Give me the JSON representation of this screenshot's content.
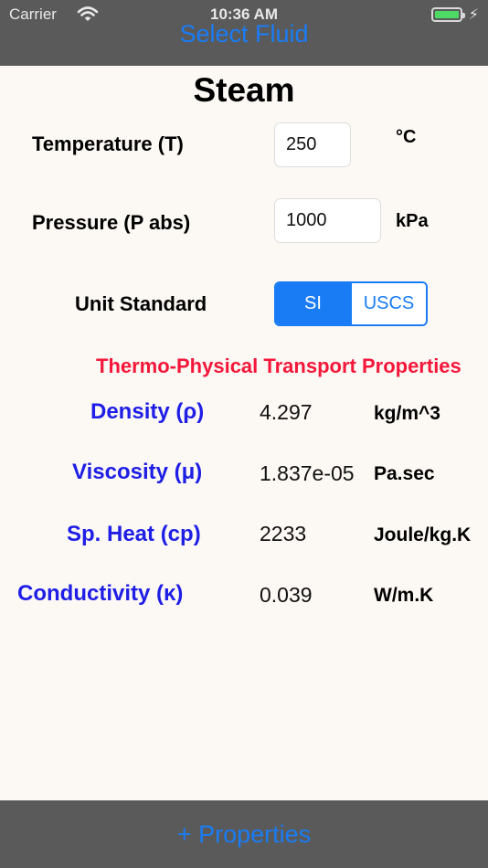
{
  "status_bar": {
    "carrier": "Carrier",
    "time": "10:36 AM",
    "wifi_icon": "wifi-icon",
    "battery_icon": "battery-icon",
    "charging_icon": "charging-bolt-icon"
  },
  "nav": {
    "select_fluid": "Select Fluid"
  },
  "fluid": {
    "name": "Steam"
  },
  "inputs": {
    "temperature": {
      "label": "Temperature (T)",
      "value": "250",
      "unit": "°C"
    },
    "pressure": {
      "label": "Pressure (P abs)",
      "value": "1000",
      "unit": "kPa"
    }
  },
  "unit_standard": {
    "label": "Unit Standard",
    "options": [
      "SI",
      "USCS"
    ],
    "selected": "SI"
  },
  "properties": {
    "title": "Thermo-Physical Transport Properties",
    "items": [
      {
        "label": "Density (ρ)",
        "value": "4.297",
        "unit": "kg/m^3"
      },
      {
        "label": "Viscosity (μ)",
        "value": "1.837e-05",
        "unit": "Pa.sec"
      },
      {
        "label": "Sp. Heat (cp)",
        "value": "2233",
        "unit": "Joule/kg.K"
      },
      {
        "label": "Conductivity (κ)",
        "value": "0.039",
        "unit": "W/m.K"
      }
    ]
  },
  "toolbar": {
    "properties_button": "+ Properties"
  },
  "colors": {
    "accent": "#1a7cf5",
    "bar_background": "#5a5a5a",
    "property_label": "#1e1ee6",
    "section_title": "#f5173a",
    "page_background": "#fcf8f4"
  }
}
